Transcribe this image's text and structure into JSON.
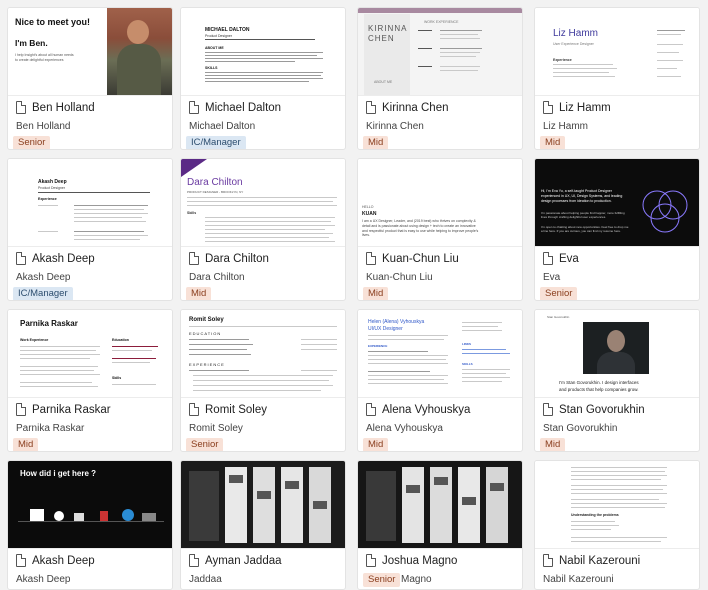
{
  "cards": [
    {
      "title": "Ben Holland",
      "subtitle": "Ben Holland",
      "badge": "Senior",
      "badge_type": "senior"
    },
    {
      "title": "Michael Dalton",
      "subtitle": "Michael Dalton",
      "badge": "IC/Manager",
      "badge_type": "ic"
    },
    {
      "title": "Kirinna Chen",
      "subtitle": "Kirinna Chen",
      "badge": "Mid",
      "badge_type": "mid"
    },
    {
      "title": "Liz Hamm",
      "subtitle": "Liz Hamm",
      "badge": "Mid",
      "badge_type": "mid"
    },
    {
      "title": "Akash Deep",
      "subtitle": "Akash Deep",
      "badge": "IC/Manager",
      "badge_type": "ic"
    },
    {
      "title": "Dara Chilton",
      "subtitle": "Dara Chilton",
      "badge": "Mid",
      "badge_type": "mid"
    },
    {
      "title": "Kuan-Chun Liu",
      "subtitle": "Kuan-Chun Liu",
      "badge": "Mid",
      "badge_type": "mid"
    },
    {
      "title": "Eva",
      "subtitle": "Eva",
      "badge": "Senior",
      "badge_type": "senior"
    },
    {
      "title": "Parnika Raskar",
      "subtitle": "Parnika Raskar",
      "badge": "Mid",
      "badge_type": "mid"
    },
    {
      "title": "Romit Soley",
      "subtitle": "Romit Soley",
      "badge": "Senior",
      "badge_type": "senior"
    },
    {
      "title": "Alena Vyhouskya",
      "subtitle": "Alena Vyhouskya",
      "badge": "Mid",
      "badge_type": "mid"
    },
    {
      "title": "Stan Govorukhin",
      "subtitle": "Stan Govorukhin",
      "badge": "Mid",
      "badge_type": "mid"
    },
    {
      "title": "Akash Deep",
      "subtitle": "Akash Deep",
      "badge": "",
      "badge_type": ""
    },
    {
      "title": "Ayman Jaddaa",
      "subtitle": "Jaddaa",
      "badge": "",
      "badge_type": ""
    },
    {
      "title": "Joshua Magno",
      "subtitle": "Joshua Magno",
      "badge": "Senior",
      "badge_type": "senior"
    },
    {
      "title": "Nabil Kazerouni",
      "subtitle": "Nabil Kazerouni",
      "badge": "",
      "badge_type": ""
    }
  ],
  "thumbs": {
    "ben": {
      "heading": "Nice to meet you!",
      "name": "I'm Ben.",
      "tagline": "I help Insight's about all human needs to create delightful experiences"
    },
    "michael": {
      "name": "MICHAEL DALTON",
      "role": "Product Designer",
      "section1": "ABOUT ME",
      "section2": "SKILLS"
    },
    "kirinna": {
      "name_line1": "KIRINNA",
      "name_line2": "CHEN",
      "label1": "WORK EXPERIENCE",
      "label2": "ABOUT ME"
    },
    "liz": {
      "name": "Liz Hamm",
      "role": "User Experience Designer",
      "label": "Experience"
    },
    "akash": {
      "name": "Akash Deep",
      "role": "Product Designer",
      "label": "Experience"
    },
    "dara": {
      "name": "Dara Chilton",
      "role": "PRODUCT DESIGNER - BROOKLYN, NY",
      "label": "Skills"
    },
    "kuan": {
      "hello": "HELLO",
      "name": "KUAN",
      "text": "I am a UX Designer, Leader, and (2019 best) who thrives on complexity & detail and is passionate about using design + tech to create an innovative and respectful product that is easy to use while helping to improve people's lives."
    },
    "eva": {
      "intro": "Hi, I'm Eva Yu, a self-taught Product Designer experienced in UX, UI, Design Systems, and leading design processes from ideation to production.",
      "line2": "I'm passionate about helping people find happier, more fulfilling lives through crafting delightful user experiences.",
      "line3": "I'm open to chatting about new opportunities. Feel free to drop me a line here. If you are curious, you can find my resume here."
    },
    "parnika": {
      "name": "Parnika Raskar",
      "label1": "Work Experience",
      "label2": "Education",
      "label3": "Skills"
    },
    "romit": {
      "name": "Romit Soley",
      "label1": "EDUCATION",
      "label2": "EXPERIENCE"
    },
    "alena": {
      "name": "Helen (Alena) Vyhouskya",
      "role": "UI/UX Designer",
      "label1": "EXPERIENCE",
      "label2": "LINKS",
      "label3": "SKILLS"
    },
    "stan": {
      "tag": "Stan Govorukhin",
      "line1": "I'm Stan Govorukhin. I design interfaces",
      "line2": "and products that help companies grow."
    },
    "akash2": {
      "heading": "How did i get here ?"
    },
    "nabil": {
      "label": "Understanding the problems"
    }
  }
}
